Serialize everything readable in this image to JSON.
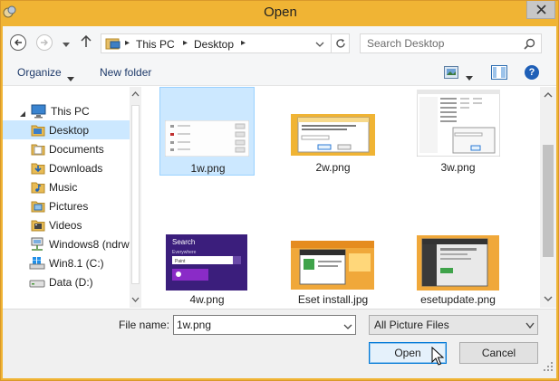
{
  "window": {
    "title": "Open",
    "app_icon": "app-icon",
    "close_icon": "close-icon"
  },
  "navigation": {
    "back_icon": "back-arrow-icon",
    "forward_icon": "forward-arrow-icon",
    "recent_icon": "chevron-down-icon",
    "up_icon": "up-arrow-icon",
    "breadcrumb": [
      "This PC",
      "Desktop"
    ],
    "refresh_icon": "refresh-icon"
  },
  "search": {
    "placeholder": "Search Desktop",
    "value": "",
    "icon": "search-icon"
  },
  "toolbar": {
    "organize_label": "Organize",
    "new_folder_label": "New folder",
    "views_icon": "views-icon",
    "preview_icon": "preview-pane-icon",
    "help_icon": "help-icon",
    "help_glyph": "?"
  },
  "sidebar": {
    "items": [
      {
        "label": "This PC",
        "icon": "computer-icon",
        "selected": false
      },
      {
        "label": "Desktop",
        "icon": "folder-icon",
        "selected": true
      },
      {
        "label": "Documents",
        "icon": "folder-icon",
        "selected": false
      },
      {
        "label": "Downloads",
        "icon": "folder-icon",
        "selected": false
      },
      {
        "label": "Music",
        "icon": "folder-icon",
        "selected": false
      },
      {
        "label": "Pictures",
        "icon": "folder-icon",
        "selected": false
      },
      {
        "label": "Videos",
        "icon": "folder-icon",
        "selected": false
      },
      {
        "label": "Windows8 (ndrw",
        "icon": "network-drive-icon",
        "selected": false
      },
      {
        "label": "Win8.1 (C:)",
        "icon": "windows-drive-icon",
        "selected": false
      },
      {
        "label": "Data (D:)",
        "icon": "drive-icon",
        "selected": false
      }
    ]
  },
  "files": [
    {
      "name": "1w.png",
      "selected": true
    },
    {
      "name": "2w.png",
      "selected": false
    },
    {
      "name": "3w.png",
      "selected": false
    },
    {
      "name": "4w.png",
      "selected": false
    },
    {
      "name": "Eset install.jpg",
      "selected": false
    },
    {
      "name": "esetupdate.png",
      "selected": false
    }
  ],
  "thumbnail_text": {
    "w4_title": "Search",
    "w4_subtitle": "Everywhere",
    "w4_query": "Paint"
  },
  "footer": {
    "file_name_label": "File name:",
    "file_name_value": "1w.png",
    "filter_value": "All Picture Files",
    "open_label": "Open",
    "cancel_label": "Cancel"
  },
  "colors": {
    "window_frame": "#f0b434",
    "selection": "#cce8ff",
    "accent": "#0078d7"
  }
}
